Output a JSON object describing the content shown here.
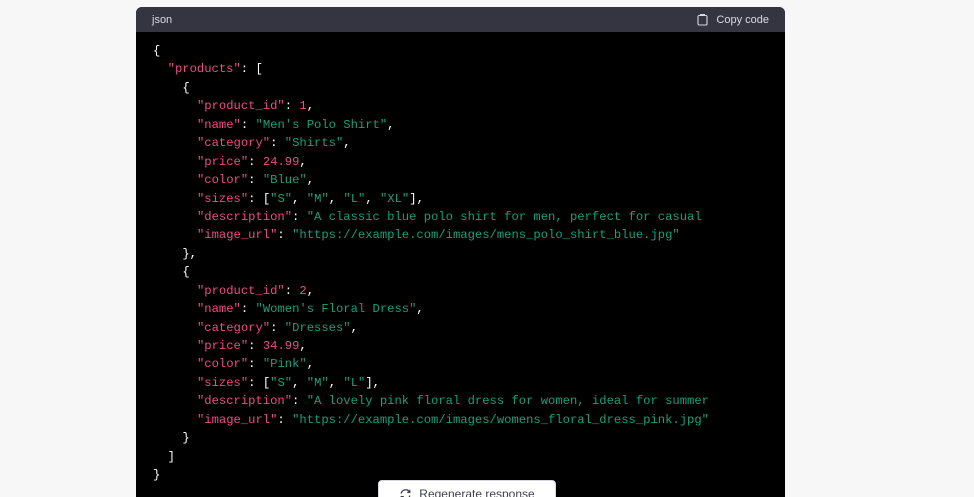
{
  "code_block": {
    "language": "json",
    "copy_label": "Copy code",
    "lines": [
      "{",
      "  \"products\": [",
      "    {",
      "      \"product_id\": 1,",
      "      \"name\": \"Men's Polo Shirt\",",
      "      \"category\": \"Shirts\",",
      "      \"price\": 24.99,",
      "      \"color\": \"Blue\",",
      "      \"sizes\": [\"S\", \"M\", \"L\", \"XL\"],",
      "      \"description\": \"A classic blue polo shirt for men, perfect for casual",
      "      \"image_url\": \"https://example.com/images/mens_polo_shirt_blue.jpg\"",
      "    },",
      "    {",
      "      \"product_id\": 2,",
      "      \"name\": \"Women's Floral Dress\",",
      "      \"category\": \"Dresses\",",
      "      \"price\": 34.99,",
      "      \"color\": \"Pink\",",
      "      \"sizes\": [\"S\", \"M\", \"L\"],",
      "      \"description\": \"A lovely pink floral dress for women, ideal for summer",
      "      \"image_url\": \"https://example.com/images/womens_floral_dress_pink.jpg\"",
      "    }",
      "  ]",
      "}"
    ]
  },
  "footer": {
    "regenerate_label": "Regenerate response"
  },
  "colors": {
    "code_background": "#000000",
    "header_background": "#343541",
    "key_color": "#ef4b85",
    "string_color": "#16a07c",
    "number_color": "#ef4b85"
  },
  "icons": {
    "copy": "clipboard-icon",
    "regenerate": "refresh-icon"
  }
}
